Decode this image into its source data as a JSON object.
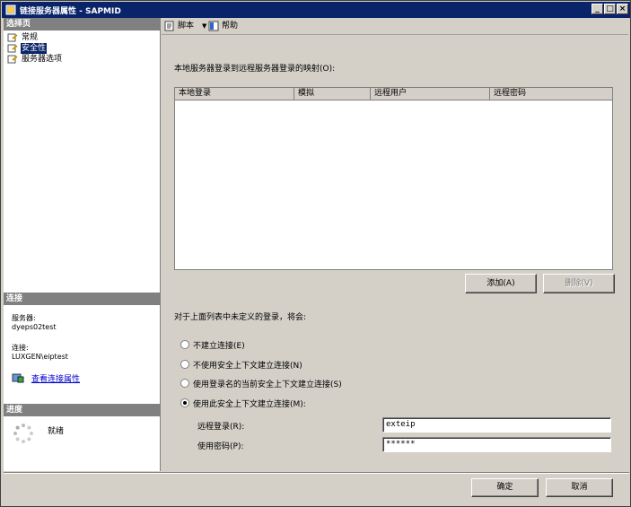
{
  "window": {
    "title": "链接服务器属性 - SAPMID",
    "minimize": "_",
    "maximize": "□",
    "close": "×"
  },
  "left": {
    "select_page_header": "选择页",
    "nav": [
      {
        "label": "常规",
        "icon": "page-icon"
      },
      {
        "label": "安全性",
        "icon": "page-icon",
        "selected": true
      },
      {
        "label": "服务器选项",
        "icon": "page-icon"
      }
    ],
    "connection_header": "连接",
    "server_label": "服务器:",
    "server_value": "dyeps02test",
    "conn_label": "连接:",
    "conn_value": "LUXGEN\\eiptest",
    "view_conn_props": "查看连接属性",
    "progress_header": "进度",
    "progress_status": "就绪"
  },
  "toolbar": {
    "script_label": "脚本",
    "help_label": "帮助"
  },
  "main": {
    "mapping_label": "本地服务器登录到远程服务器登录的映射(O):",
    "columns": [
      "本地登录",
      "模拟",
      "远程用户",
      "远程密码"
    ],
    "rows": [],
    "add_button": "添加(A)",
    "remove_button": "删除(V)",
    "undefined_label": "对于上面列表中未定义的登录，将会:",
    "options": [
      {
        "label": "不建立连接(E)",
        "checked": false
      },
      {
        "label": "不使用安全上下文建立连接(N)",
        "checked": false
      },
      {
        "label": "使用登录名的当前安全上下文建立连接(S)",
        "checked": false
      },
      {
        "label": "使用此安全上下文建立连接(M):",
        "checked": true
      }
    ],
    "remote_login_label": "远程登录(R):",
    "remote_login_value": "exteip",
    "password_label": "使用密码(P):",
    "password_value": "******"
  },
  "footer": {
    "ok_button": "确定",
    "cancel_button": "取消"
  },
  "colors": {
    "titlebar": "#0a246a",
    "dialog_bg": "#d4d0c8",
    "link": "#0000cc"
  }
}
